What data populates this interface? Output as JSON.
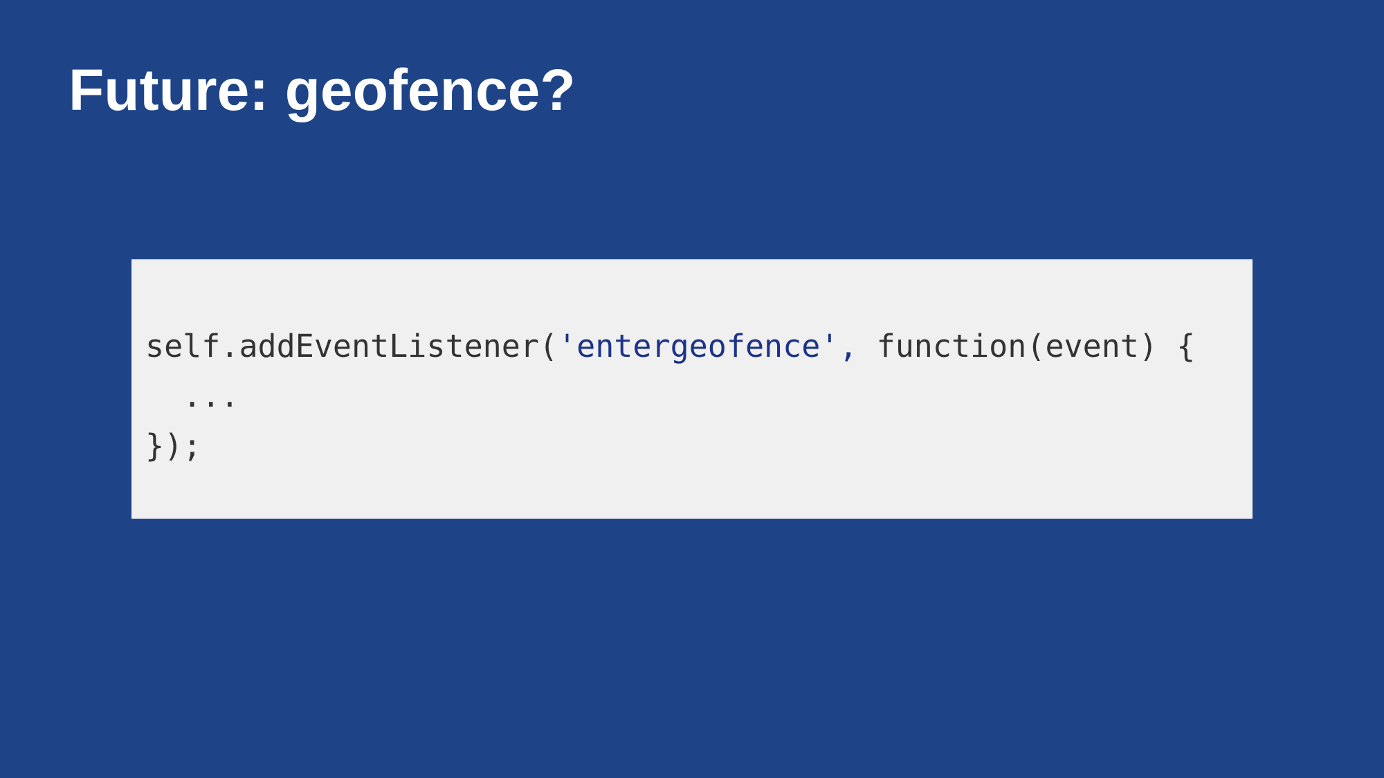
{
  "slide": {
    "title": "Future: geofence?",
    "colors": {
      "background": "#1e4487",
      "title_text": "#ffffff",
      "code_background": "#f0f0f0",
      "code_text": "#333333",
      "code_string": "#1c3388"
    }
  },
  "code": {
    "line1": {
      "prefix": "self.addEventListener(",
      "string": "'entergeofence',",
      "suffix": " function(event) {"
    },
    "line2": "  ...",
    "line3": "});"
  }
}
